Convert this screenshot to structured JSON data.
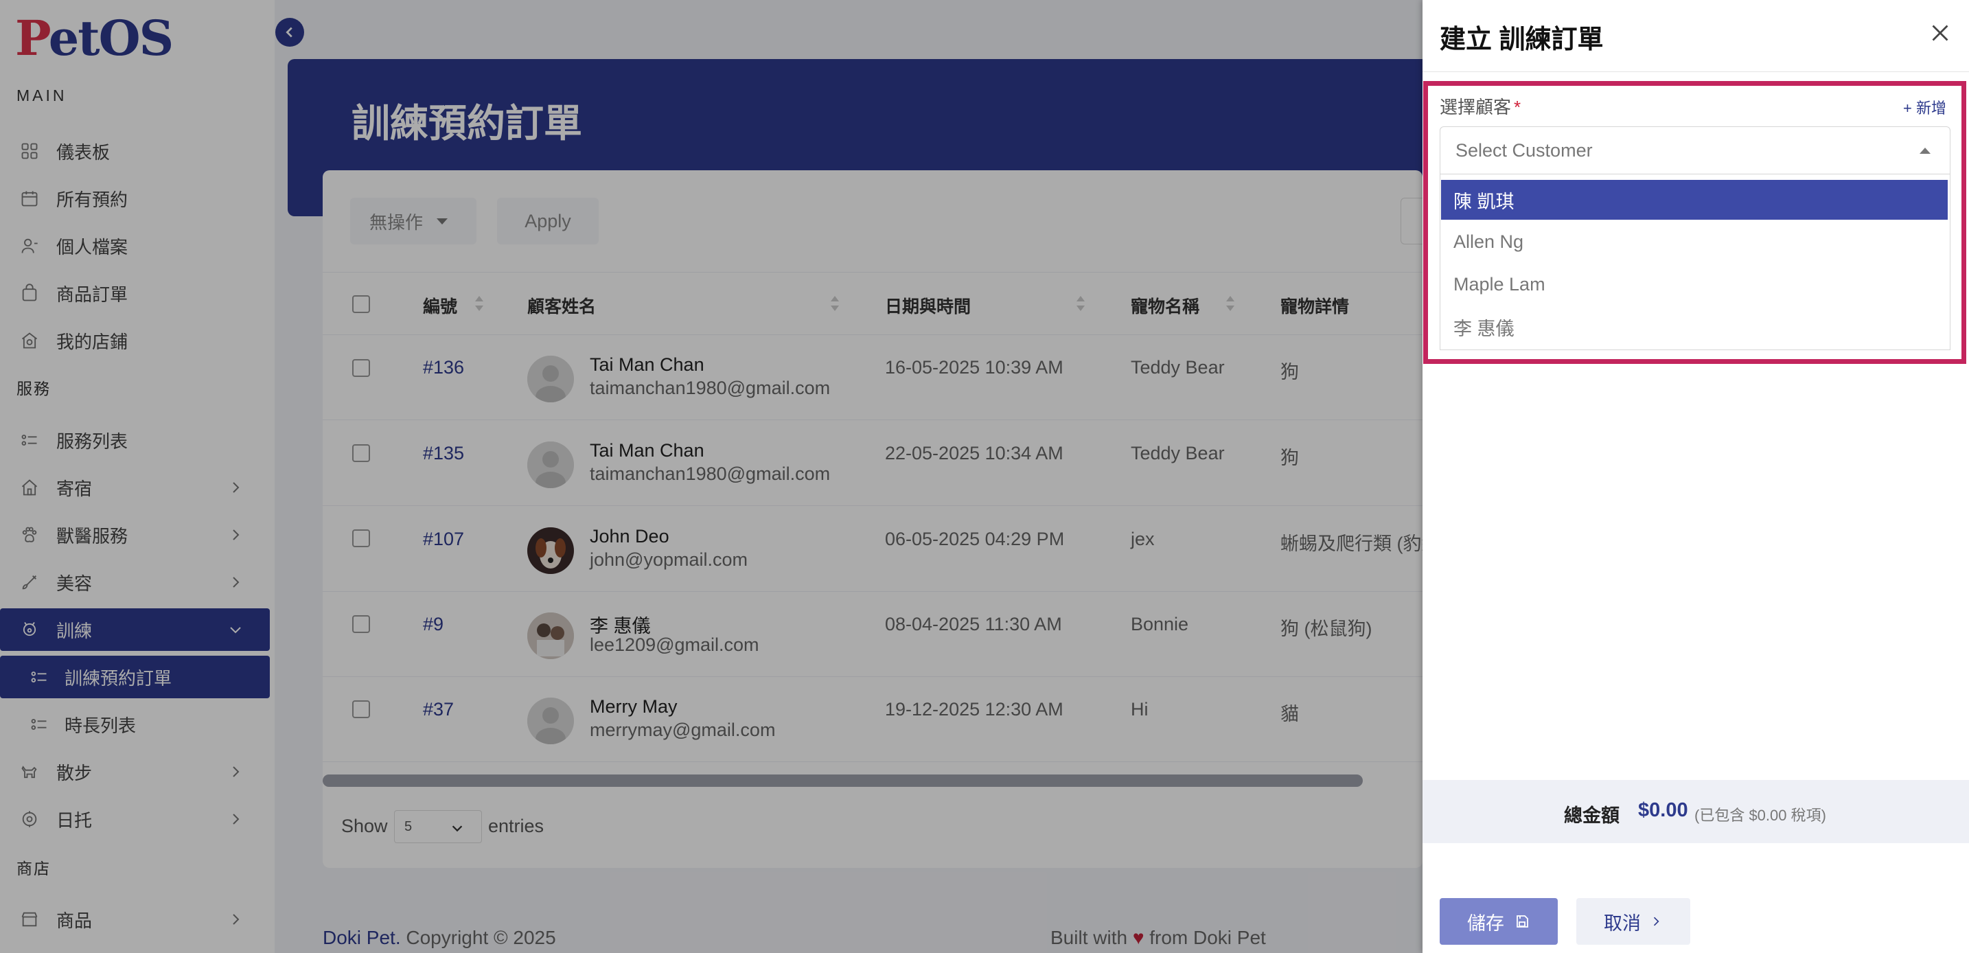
{
  "app": {
    "logo_p": "P",
    "logo_rest": "etOS"
  },
  "sidebar": {
    "section_main": "MAIN",
    "section_services": "服務",
    "section_shop": "商店",
    "items": [
      {
        "label": "儀表板",
        "icon": "dashboard-icon"
      },
      {
        "label": "所有預約",
        "icon": "calendar-icon"
      },
      {
        "label": "個人檔案",
        "icon": "user-icon"
      },
      {
        "label": "商品訂單",
        "icon": "shopping-bag-icon"
      },
      {
        "label": "我的店鋪",
        "icon": "store-icon"
      },
      {
        "label": "服務列表",
        "icon": "list-icon"
      },
      {
        "label": "寄宿",
        "icon": "home-icon"
      },
      {
        "label": "獸醫服務",
        "icon": "paw-icon"
      },
      {
        "label": "美容",
        "icon": "brush-icon"
      },
      {
        "label": "訓練",
        "icon": "training-icon"
      },
      {
        "label": "訓練預約訂單",
        "icon": "list-icon"
      },
      {
        "label": "時長列表",
        "icon": "list-icon"
      },
      {
        "label": "散步",
        "icon": "dog-walk-icon"
      },
      {
        "label": "日托",
        "icon": "daycare-icon"
      },
      {
        "label": "商品",
        "icon": "shop-icon"
      }
    ]
  },
  "main": {
    "page_title": "訓練預約訂單",
    "bulk_action": "無操作",
    "apply_label": "Apply",
    "columns": [
      "編號",
      "顧客姓名",
      "日期與時間",
      "寵物名稱",
      "寵物詳情"
    ],
    "rows": [
      {
        "id": "#136",
        "name": "Tai Man Chan",
        "email": "taimanchan1980@gmail.com",
        "datetime": "16-05-2025 10:39 AM",
        "pet": "Teddy Bear",
        "detail": "狗"
      },
      {
        "id": "#135",
        "name": "Tai Man Chan",
        "email": "taimanchan1980@gmail.com",
        "datetime": "22-05-2025 10:34 AM",
        "pet": "Teddy Bear",
        "detail": "狗"
      },
      {
        "id": "#107",
        "name": "John Deo",
        "email": "john@yopmail.com",
        "datetime": "06-05-2025 04:29 PM",
        "pet": "jex",
        "detail": "蜥蜴及爬行類 (豹紋"
      },
      {
        "id": "#9",
        "name": "李 惠儀",
        "email": "lee1209@gmail.com",
        "datetime": "08-04-2025 11:30 AM",
        "pet": "Bonnie",
        "detail": "狗 (松鼠狗)"
      },
      {
        "id": "#37",
        "name": "Merry May",
        "email": "merrymay@gmail.com",
        "datetime": "19-12-2025 12:30 AM",
        "pet": "Hi",
        "detail": "貓"
      }
    ],
    "show_label": "Show",
    "entries_value": "5",
    "entries_label": "entries"
  },
  "footer": {
    "brand": "Doki Pet.",
    "copyright": " Copyright © 2025",
    "built_prefix": "Built with ",
    "heart": "♥",
    "built_suffix": " from Doki Pet"
  },
  "drawer": {
    "title": "建立 訓練訂單",
    "customer_label": "選擇顧客",
    "required_mark": "*",
    "add_new": "+ 新增",
    "select_placeholder": "Select Customer",
    "options": [
      "陳 凱琪",
      "Allen Ng",
      "Maple Lam",
      "李 惠儀"
    ],
    "selected_option": "陳 凱琪",
    "total_label": "總金額",
    "total_value": "$0.00",
    "total_note": "(已包含 $0.00 稅項)",
    "save_label": "儲存",
    "cancel_label": "取消"
  },
  "colors": {
    "primary": "#2d3a8c",
    "highlight": "#c3255d",
    "selected_option": "#3d4aa6"
  }
}
